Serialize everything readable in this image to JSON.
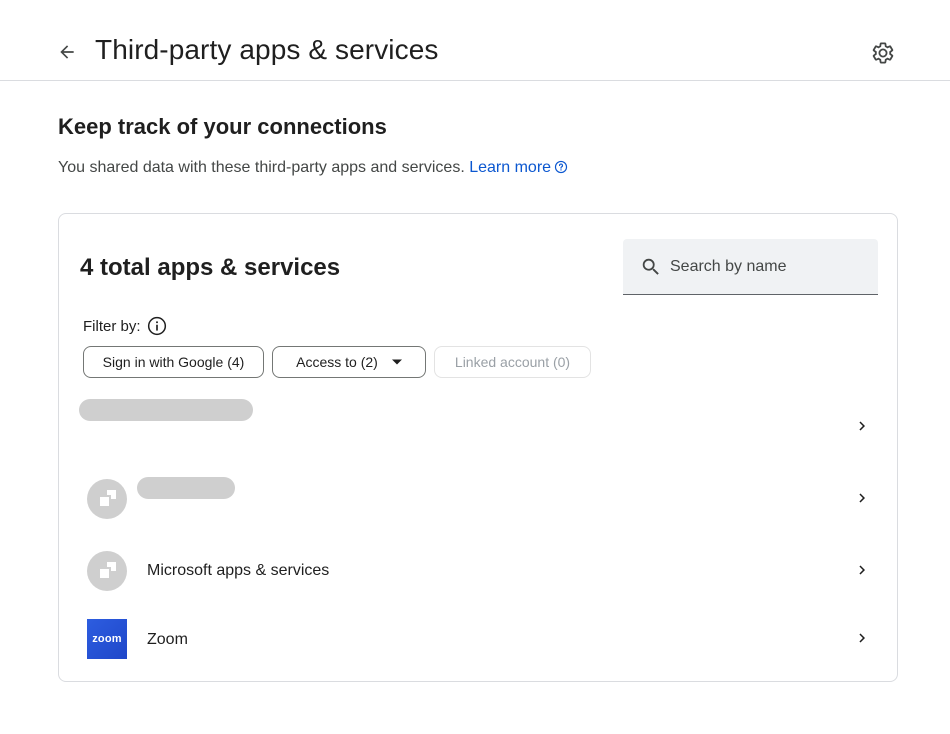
{
  "header": {
    "title": "Third-party apps & services",
    "back_icon": "arrow-left-icon",
    "settings_icon": "gear-icon"
  },
  "intro": {
    "heading": "Keep track of your connections",
    "description": "You shared data with these third-party apps and services.",
    "learn_more": "Learn more"
  },
  "card": {
    "title": "4 total apps & services",
    "search": {
      "placeholder": "Search by name",
      "value": ""
    },
    "filter_label": "Filter by:",
    "chips": [
      {
        "label": "Sign in with Google (4)",
        "enabled": true
      },
      {
        "label": "Access to (2)",
        "enabled": true,
        "dropdown": true
      },
      {
        "label": "Linked account (0)",
        "enabled": false
      }
    ],
    "apps": [
      {
        "name": "",
        "icon": "redacted"
      },
      {
        "name": "",
        "icon": "generic-app-icon"
      },
      {
        "name": "Microsoft apps & services",
        "icon": "generic-app-icon"
      },
      {
        "name": "Zoom",
        "icon": "zoom-logo",
        "logo_text": "zoom"
      }
    ]
  },
  "colors": {
    "link": "#0b57d0",
    "border": "#dadce0",
    "search_bg": "#f0f2f4",
    "zoom_brand": "#2d5de0"
  }
}
